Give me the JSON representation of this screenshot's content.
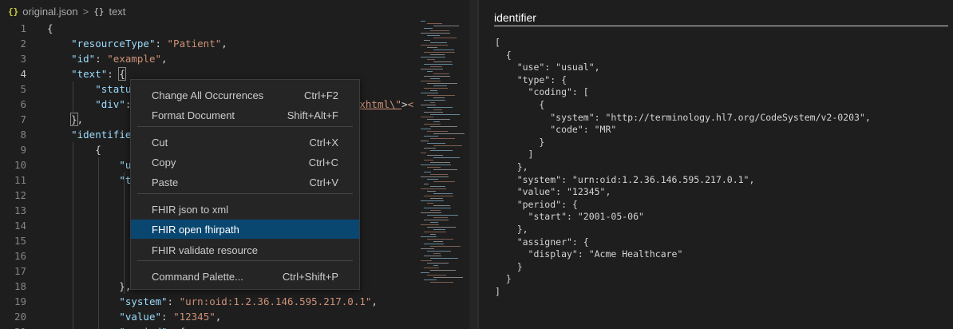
{
  "breadcrumb": {
    "json_icon": "{}",
    "file": "original.json",
    "separator": ">",
    "symbol_icon": "{}",
    "symbol": "text"
  },
  "editor": {
    "lines": [
      {
        "n": "1",
        "t": [
          [
            "p",
            "{"
          ]
        ]
      },
      {
        "n": "2",
        "t": [
          [
            "p",
            "    "
          ],
          [
            "k",
            "\"resourceType\""
          ],
          [
            "p",
            ": "
          ],
          [
            "s",
            "\"Patient\""
          ],
          [
            "p",
            ","
          ]
        ]
      },
      {
        "n": "3",
        "t": [
          [
            "p",
            "    "
          ],
          [
            "k",
            "\"id\""
          ],
          [
            "p",
            ": "
          ],
          [
            "s",
            "\"example\""
          ],
          [
            "p",
            ","
          ]
        ]
      },
      {
        "n": "4",
        "t": [
          [
            "p",
            "    "
          ],
          [
            "k",
            "\"text\""
          ],
          [
            "p",
            ": "
          ],
          [
            "b",
            "{"
          ]
        ]
      },
      {
        "n": "5",
        "t": [
          [
            "p",
            "        "
          ],
          [
            "k",
            "\"statu"
          ]
        ]
      },
      {
        "n": "6",
        "t": [
          [
            "p",
            "        "
          ],
          [
            "k",
            "\"div\""
          ],
          [
            "p",
            ":"
          ],
          [
            "p",
            "                                     "
          ],
          [
            "u",
            "/xhtml\\\""
          ],
          [
            "p",
            ">"
          ],
          [
            "s",
            "<"
          ]
        ]
      },
      {
        "n": "7",
        "t": [
          [
            "p",
            "    "
          ],
          [
            "b",
            "}"
          ],
          [
            "p",
            ","
          ]
        ]
      },
      {
        "n": "8",
        "t": [
          [
            "p",
            "    "
          ],
          [
            "k",
            "\"identifie"
          ]
        ]
      },
      {
        "n": "9",
        "t": [
          [
            "p",
            "        {"
          ]
        ]
      },
      {
        "n": "10",
        "t": [
          [
            "p",
            "            "
          ],
          [
            "k",
            "\"u"
          ]
        ]
      },
      {
        "n": "11",
        "t": [
          [
            "p",
            "            "
          ],
          [
            "k",
            "\"t"
          ]
        ]
      },
      {
        "n": "12",
        "t": []
      },
      {
        "n": "13",
        "t": []
      },
      {
        "n": "14",
        "t": [
          [
            "p",
            "                                        "
          ],
          [
            "u",
            "gy.hl7.org"
          ]
        ]
      },
      {
        "n": "15",
        "t": []
      },
      {
        "n": "16",
        "t": []
      },
      {
        "n": "17",
        "t": []
      },
      {
        "n": "18",
        "t": [
          [
            "p",
            "            },"
          ]
        ]
      },
      {
        "n": "19",
        "t": [
          [
            "p",
            "            "
          ],
          [
            "k",
            "\"system\""
          ],
          [
            "p",
            ": "
          ],
          [
            "s",
            "\"urn:oid:1.2.36.146.595.217.0.1\""
          ],
          [
            "p",
            ","
          ]
        ]
      },
      {
        "n": "20",
        "t": [
          [
            "p",
            "            "
          ],
          [
            "k",
            "\"value\""
          ],
          [
            "p",
            ": "
          ],
          [
            "s",
            "\"12345\""
          ],
          [
            "p",
            ","
          ]
        ]
      },
      {
        "n": "21",
        "t": [
          [
            "p",
            "            "
          ],
          [
            "k",
            "\"period\""
          ],
          [
            "p",
            ": {"
          ]
        ]
      }
    ]
  },
  "context_menu": {
    "items": [
      {
        "label": "Change All Occurrences",
        "shortcut": "Ctrl+F2"
      },
      {
        "label": "Format Document",
        "shortcut": "Shift+Alt+F"
      },
      {
        "label": "Cut",
        "shortcut": "Ctrl+X"
      },
      {
        "label": "Copy",
        "shortcut": "Ctrl+C"
      },
      {
        "label": "Paste",
        "shortcut": "Ctrl+V"
      },
      {
        "label": "FHIR json to xml",
        "shortcut": ""
      },
      {
        "label": "FHIR open fhirpath",
        "shortcut": ""
      },
      {
        "label": "FHIR validate resource",
        "shortcut": ""
      },
      {
        "label": "Command Palette...",
        "shortcut": "Ctrl+Shift+P"
      }
    ],
    "active_label": "FHIR open fhirpath"
  },
  "panel": {
    "title": "identifier",
    "content": "[\n  {\n    \"use\": \"usual\",\n    \"type\": {\n      \"coding\": [\n        {\n          \"system\": \"http://terminology.hl7.org/CodeSystem/v2-0203\",\n          \"code\": \"MR\"\n        }\n      ]\n    },\n    \"system\": \"urn:oid:1.2.36.146.595.217.0.1\",\n    \"value\": \"12345\",\n    \"period\": {\n      \"start\": \"2001-05-06\"\n    },\n    \"assigner\": {\n      \"display\": \"Acme Healthcare\"\n    }\n  }\n]"
  },
  "colors": {
    "key": "#9cdcfe",
    "string": "#ce9178",
    "menu_active": "#094771",
    "json_icon": "#cbcb41"
  }
}
